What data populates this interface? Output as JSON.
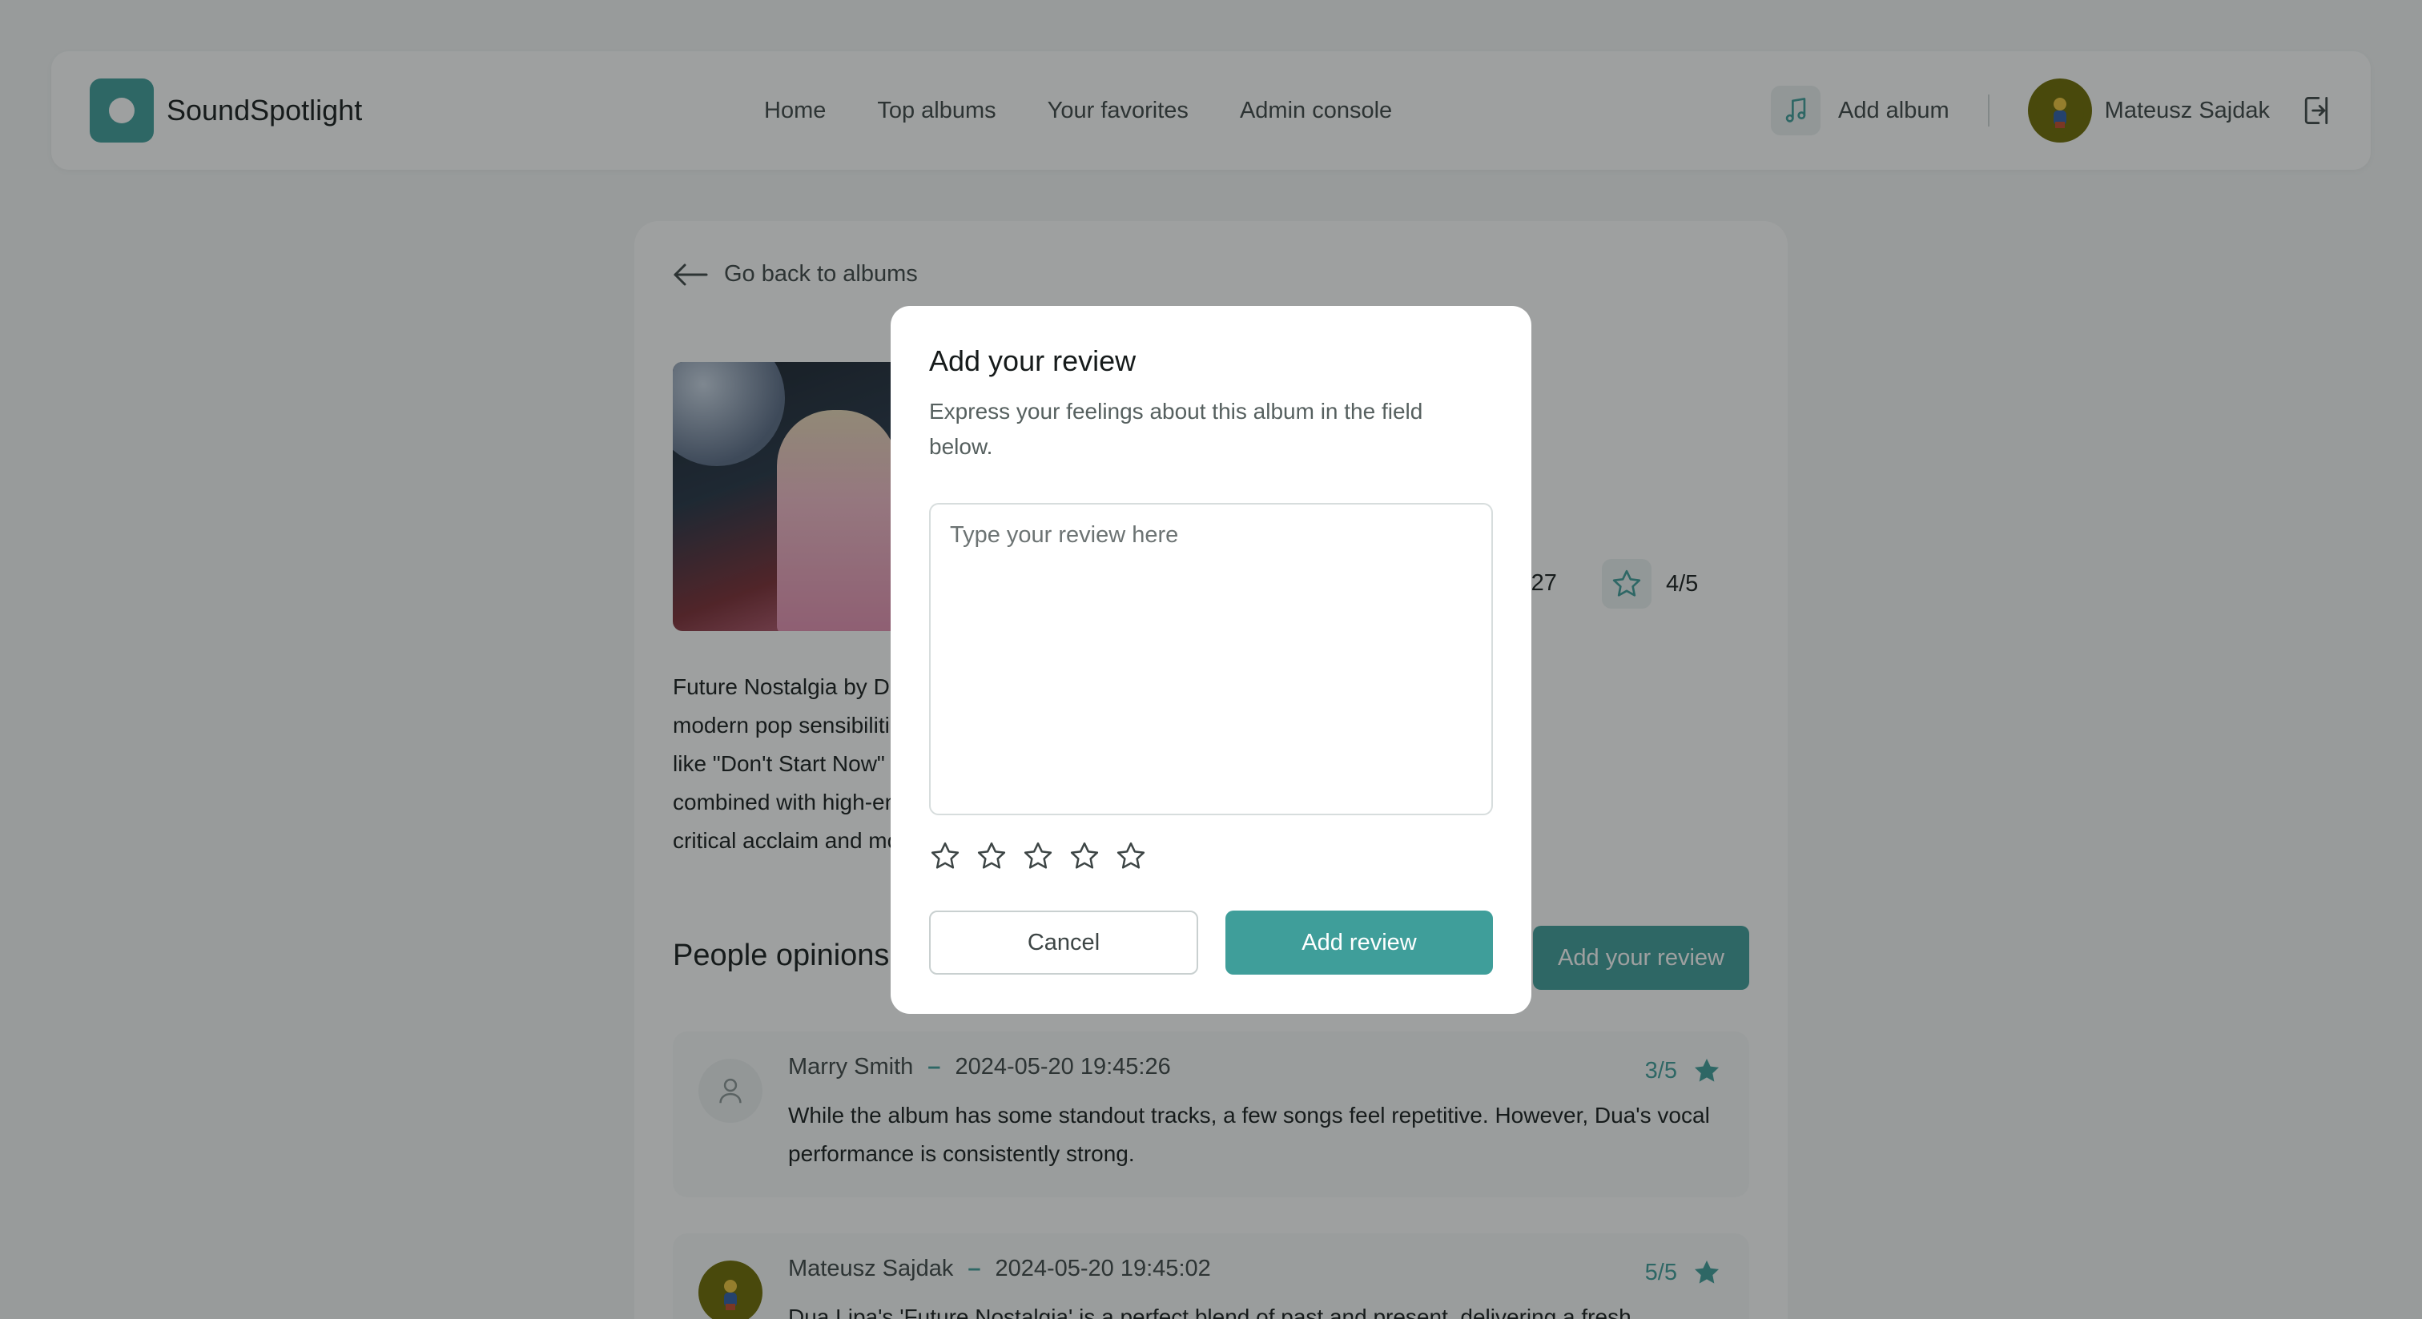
{
  "app": {
    "brand": "SoundSpotlight"
  },
  "nav": {
    "items": [
      {
        "label": "Home"
      },
      {
        "label": "Top albums"
      },
      {
        "label": "Your favorites"
      },
      {
        "label": "Admin console"
      }
    ]
  },
  "header": {
    "add_album_label": "Add album",
    "user_name": "Mateusz Sajdak"
  },
  "album": {
    "back_label": "Go back to albums",
    "date_fragment": "-27",
    "rating": "4/5",
    "description_lines": [
      "Future Nostalgia by Dua Lipa blends retro disco vibes with",
      "modern pop sensibilities. The album features hits",
      "like \"Don't Start Now\" with confident delivery,",
      "combined with high-energy genre. It has received",
      "critical acclaim and more."
    ]
  },
  "opinions": {
    "title": "People opinions",
    "add_button": "Add your review",
    "reviews": [
      {
        "author": "Marry Smith",
        "date": "2024-05-20 19:45:26",
        "score": "3/5",
        "text": "While the album has some standout tracks, a few songs feel repetitive. However, Dua's vocal performance is consistently strong."
      },
      {
        "author": "Mateusz Sajdak",
        "date": "2024-05-20 19:45:02",
        "score": "5/5",
        "text": "Dua Lipa's 'Future Nostalgia' is a perfect blend of past and present, delivering a fresh"
      }
    ]
  },
  "modal": {
    "title": "Add your review",
    "subtitle": "Express your feelings about this album in the field below.",
    "placeholder": "Type your review here",
    "star_count": 5,
    "cancel_label": "Cancel",
    "submit_label": "Add review"
  },
  "colors": {
    "accent": "#3f9e9a",
    "overlay": "rgba(24,28,28,0.42)"
  }
}
